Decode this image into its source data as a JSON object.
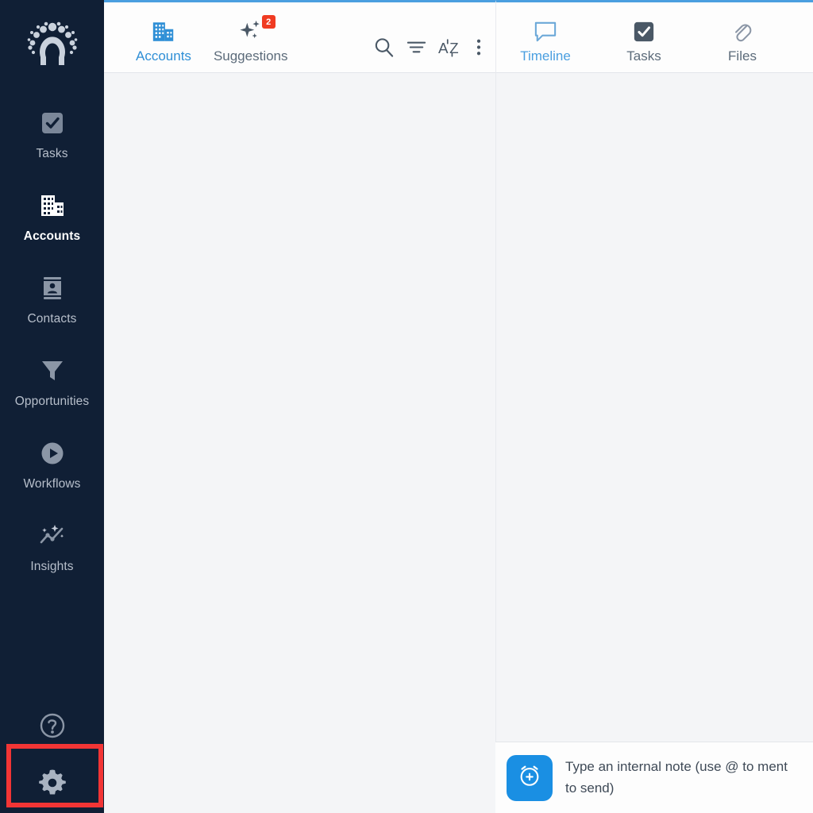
{
  "theme": {
    "rail_bg": "#101f35",
    "accent_blue": "#2f8fd6",
    "top_border": "#4a9fe0",
    "annotation_red": "#f23535",
    "badge_red": "#f03b22",
    "pane_bg": "#f4f5f7",
    "bar_bg": "#fdfdfd"
  },
  "sidebar": {
    "logo_name": "horseshoe-dots-logo",
    "items": [
      {
        "label": "Tasks",
        "icon": "checkbox-icon",
        "active": false
      },
      {
        "label": "Accounts",
        "icon": "building-icon",
        "active": true
      },
      {
        "label": "Contacts",
        "icon": "contact-card-icon",
        "active": false
      },
      {
        "label": "Opportunities",
        "icon": "funnel-icon",
        "active": false
      },
      {
        "label": "Workflows",
        "icon": "play-circle-icon",
        "active": false
      },
      {
        "label": "Insights",
        "icon": "chart-sparkle-icon",
        "active": false
      }
    ],
    "bottom": [
      {
        "label": "Help",
        "icon": "question-circle-icon"
      },
      {
        "label": "Settings",
        "icon": "gear-icon"
      }
    ]
  },
  "annotation": {
    "highlight_target": "Settings",
    "arrow_direction": "left",
    "color": "#f23535"
  },
  "list_pane": {
    "tabs": [
      {
        "label": "Accounts",
        "icon": "building-icon",
        "active": true,
        "badge": ""
      },
      {
        "label": "Suggestions",
        "icon": "sparkle-icon",
        "active": false,
        "badge": "2"
      }
    ],
    "actions": [
      {
        "name": "search-icon",
        "label": "Search"
      },
      {
        "name": "filter-icon",
        "label": "Filter"
      },
      {
        "name": "sort-alpha-icon",
        "label": "A-Z"
      },
      {
        "name": "more-vertical-icon",
        "label": "More"
      }
    ],
    "content": ""
  },
  "detail_pane": {
    "tabs": [
      {
        "label": "Timeline",
        "icon": "chat-bubble-icon",
        "active": true
      },
      {
        "label": "Tasks",
        "icon": "checkbox-icon",
        "active": false
      },
      {
        "label": "Files",
        "icon": "paperclip-icon",
        "active": false
      }
    ],
    "content": "",
    "composer": {
      "button_icon": "alarm-plus-icon",
      "placeholder_line1": "Type an internal note (use @ to ment",
      "placeholder_line2": "to send)"
    }
  }
}
